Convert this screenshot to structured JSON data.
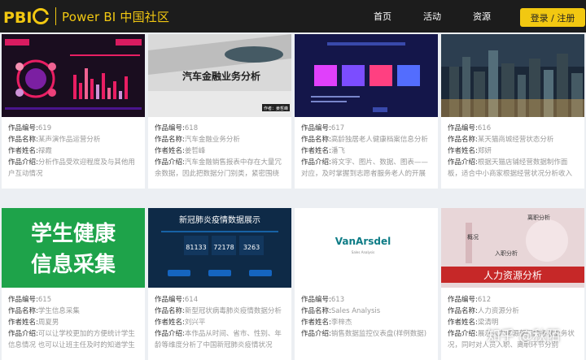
{
  "header": {
    "logo_text": "Power BI 中国社区",
    "nav": [
      "首页",
      "活动",
      "资源"
    ],
    "login_label": "登录 / 注册",
    "accent_color": "#f2c811"
  },
  "labels": {
    "id": "作品编号:",
    "name": "作品名称:",
    "author": "作者姓名:",
    "desc": "作品介绍:"
  },
  "cards": [
    {
      "id": "619",
      "name": "某声演作品运营分析",
      "author": "禄霞",
      "desc": "分析作品受欢迎程度及与其他用户互动情况",
      "thumb_text": ""
    },
    {
      "id": "618",
      "name": "汽车金融业务分析",
      "author": "姜哲峰",
      "desc": "汽车金融销售报表中存在大量冗余数据，因此把数据分门别类，紧密围绕",
      "thumb_text": "汽车金融业务分析",
      "thumb_sub": "作者：姜哲峰"
    },
    {
      "id": "617",
      "name": "高龄独居老人健康档案信息分析",
      "author": "潘飞",
      "desc": "将文字、图片、数据、图表——对应，及时掌握到志愿者服务老人的开展",
      "thumb_text": ""
    },
    {
      "id": "616",
      "name": "某天猫商城经营状态分析",
      "author": "郑妍",
      "desc": "根据天猫店铺经营数据制作面板，适合中小商家根据经营状况分析收入",
      "thumb_text": ""
    },
    {
      "id": "615",
      "name": "学生信息采集",
      "author": "周夏男",
      "desc": "可以让学校更加的方便统计学生信息情况 也可以让班主任及时的知道学生",
      "thumb_text": "学生健康信息采集"
    },
    {
      "id": "614",
      "name": "新型冠状病毒肺炎疫情数据分析",
      "author": "刘兴平",
      "desc": "本作品从时间、省市、性别、年龄等维度分析了中国新冠肺炎疫情状况",
      "thumb_text": "新冠肺炎疫情数据展示",
      "thumb_nums": [
        "81133",
        "72178",
        "3263"
      ]
    },
    {
      "id": "613",
      "name": "Sales Analysis",
      "author": "李梓杰",
      "desc": "销售数据监控仪表盘(样例数据)",
      "thumb_text": "VanArsdel",
      "thumb_sub": "Sales Analysis"
    },
    {
      "id": "612",
      "name": "人力资源分析",
      "author": "梁清明",
      "desc": "展示人力资源部门的各项业务状况，同时对人员入职、离职环节分别",
      "thumb_text": "人力资源分析",
      "thumb_tags": [
        "离职分析",
        "概况",
        "入职分析"
      ]
    }
  ],
  "watermark": "知乎 @秋陌"
}
